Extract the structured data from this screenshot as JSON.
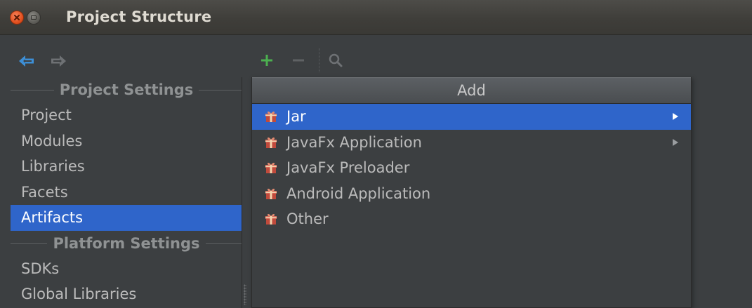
{
  "window": {
    "title": "Project Structure"
  },
  "toolbar": {
    "back_icon": "back-arrow-icon",
    "forward_icon": "forward-arrow-icon",
    "add_icon": "plus-icon",
    "remove_icon": "minus-icon",
    "find_icon": "magnifier-icon",
    "add_color": "#4cb050",
    "nav_color": "#3d8fd6"
  },
  "sidebar": {
    "project_settings_header": "Project Settings",
    "project_items": [
      {
        "label": "Project"
      },
      {
        "label": "Modules"
      },
      {
        "label": "Libraries"
      },
      {
        "label": "Facets"
      },
      {
        "label": "Artifacts",
        "selected": true
      }
    ],
    "platform_settings_header": "Platform Settings",
    "platform_items": [
      {
        "label": "SDKs"
      },
      {
        "label": "Global Libraries"
      }
    ]
  },
  "popup": {
    "title": "Add",
    "items": [
      {
        "label": "Jar",
        "icon": "gift-icon",
        "has_submenu": true,
        "selected": true
      },
      {
        "label": "JavaFx Application",
        "icon": "gift-icon",
        "has_submenu": true
      },
      {
        "label": "JavaFx Preloader",
        "icon": "gift-icon",
        "has_submenu": false
      },
      {
        "label": "Android Application",
        "icon": "gift-icon",
        "has_submenu": false
      },
      {
        "label": "Other",
        "icon": "gift-icon",
        "has_submenu": false
      }
    ]
  },
  "colors": {
    "selection": "#2f65ca",
    "background": "#3c3f41"
  }
}
